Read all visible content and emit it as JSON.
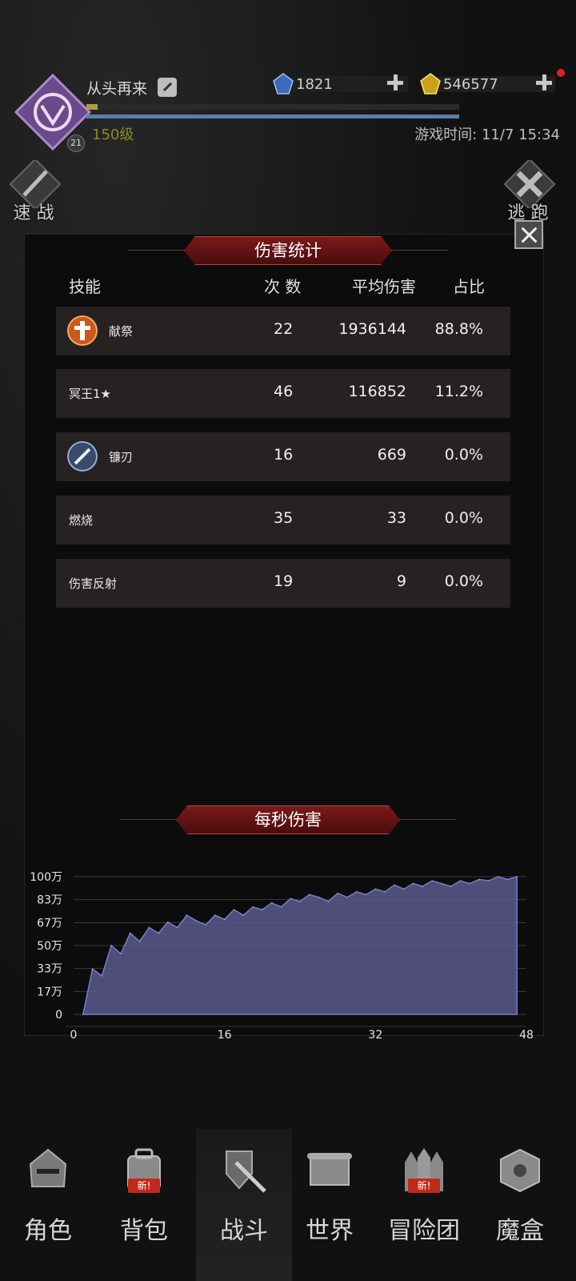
{
  "player": {
    "name": "从头再来",
    "level_text": "150级",
    "rank_badge": "21",
    "xp_fraction": 0.03,
    "game_time": "游戏时间: 11/7 15:34"
  },
  "currency": {
    "gems": "1821",
    "gold": "546577"
  },
  "side_buttons": {
    "quick_battle": "速 战",
    "escape": "逃 跑"
  },
  "damage_stats": {
    "title": "伤害统计",
    "headers": {
      "skill": "技能",
      "count": "次 数",
      "avg": "平均伤害",
      "ratio": "占比"
    },
    "rows": [
      {
        "name": "献祭",
        "count": "22",
        "avg": "1936144",
        "ratio": "88.8%",
        "icon": "sacrifice-icon"
      },
      {
        "name": "冥王1★",
        "count": "46",
        "avg": "116852",
        "ratio": "11.2%",
        "icon": ""
      },
      {
        "name": "镰刃",
        "count": "16",
        "avg": "669",
        "ratio": "0.0%",
        "icon": "scythe-blade-icon"
      },
      {
        "name": "燃烧",
        "count": "35",
        "avg": "33",
        "ratio": "0.0%",
        "icon": ""
      },
      {
        "name": "伤害反射",
        "count": "19",
        "avg": "9",
        "ratio": "0.0%",
        "icon": ""
      }
    ]
  },
  "dps": {
    "title": "每秒伤害"
  },
  "chart_data": {
    "type": "area",
    "title": "每秒伤害",
    "xlabel": "",
    "ylabel": "",
    "xlim": [
      0,
      48
    ],
    "ylim": [
      0,
      1000000
    ],
    "x_ticks": [
      "0",
      "16",
      "32",
      "48"
    ],
    "y_ticks": [
      "0",
      "17万",
      "33万",
      "50万",
      "67万",
      "83万",
      "100万"
    ],
    "grid": true,
    "series": [
      {
        "color": "#5a5a8c",
        "x": [
          1,
          2,
          3,
          4,
          5,
          6,
          7,
          8,
          9,
          10,
          11,
          12,
          13,
          14,
          15,
          16,
          17,
          18,
          19,
          20,
          21,
          22,
          23,
          24,
          25,
          26,
          27,
          28,
          29,
          30,
          31,
          32,
          33,
          34,
          35,
          36,
          37,
          38,
          39,
          40,
          41,
          42,
          43,
          44,
          45,
          46,
          47
        ],
        "values": [
          0,
          330000,
          280000,
          500000,
          440000,
          590000,
          530000,
          630000,
          590000,
          670000,
          630000,
          720000,
          680000,
          650000,
          720000,
          690000,
          760000,
          720000,
          780000,
          760000,
          810000,
          780000,
          840000,
          820000,
          870000,
          850000,
          820000,
          880000,
          850000,
          890000,
          870000,
          910000,
          890000,
          940000,
          910000,
          950000,
          930000,
          970000,
          950000,
          930000,
          970000,
          950000,
          980000,
          970000,
          1000000,
          980000,
          1000000
        ]
      }
    ]
  },
  "nav": {
    "items": [
      {
        "label": "角色",
        "icon": "helmet-icon"
      },
      {
        "label": "背包",
        "icon": "backpack-icon",
        "badge": "新!"
      },
      {
        "label": "战斗",
        "icon": "shield-sword-icon"
      },
      {
        "label": "世界",
        "icon": "scroll-map-icon"
      },
      {
        "label": "冒险团",
        "icon": "castle-icon",
        "badge": "新!"
      },
      {
        "label": "魔盒",
        "icon": "magic-box-icon"
      }
    ],
    "active_index": 2
  }
}
